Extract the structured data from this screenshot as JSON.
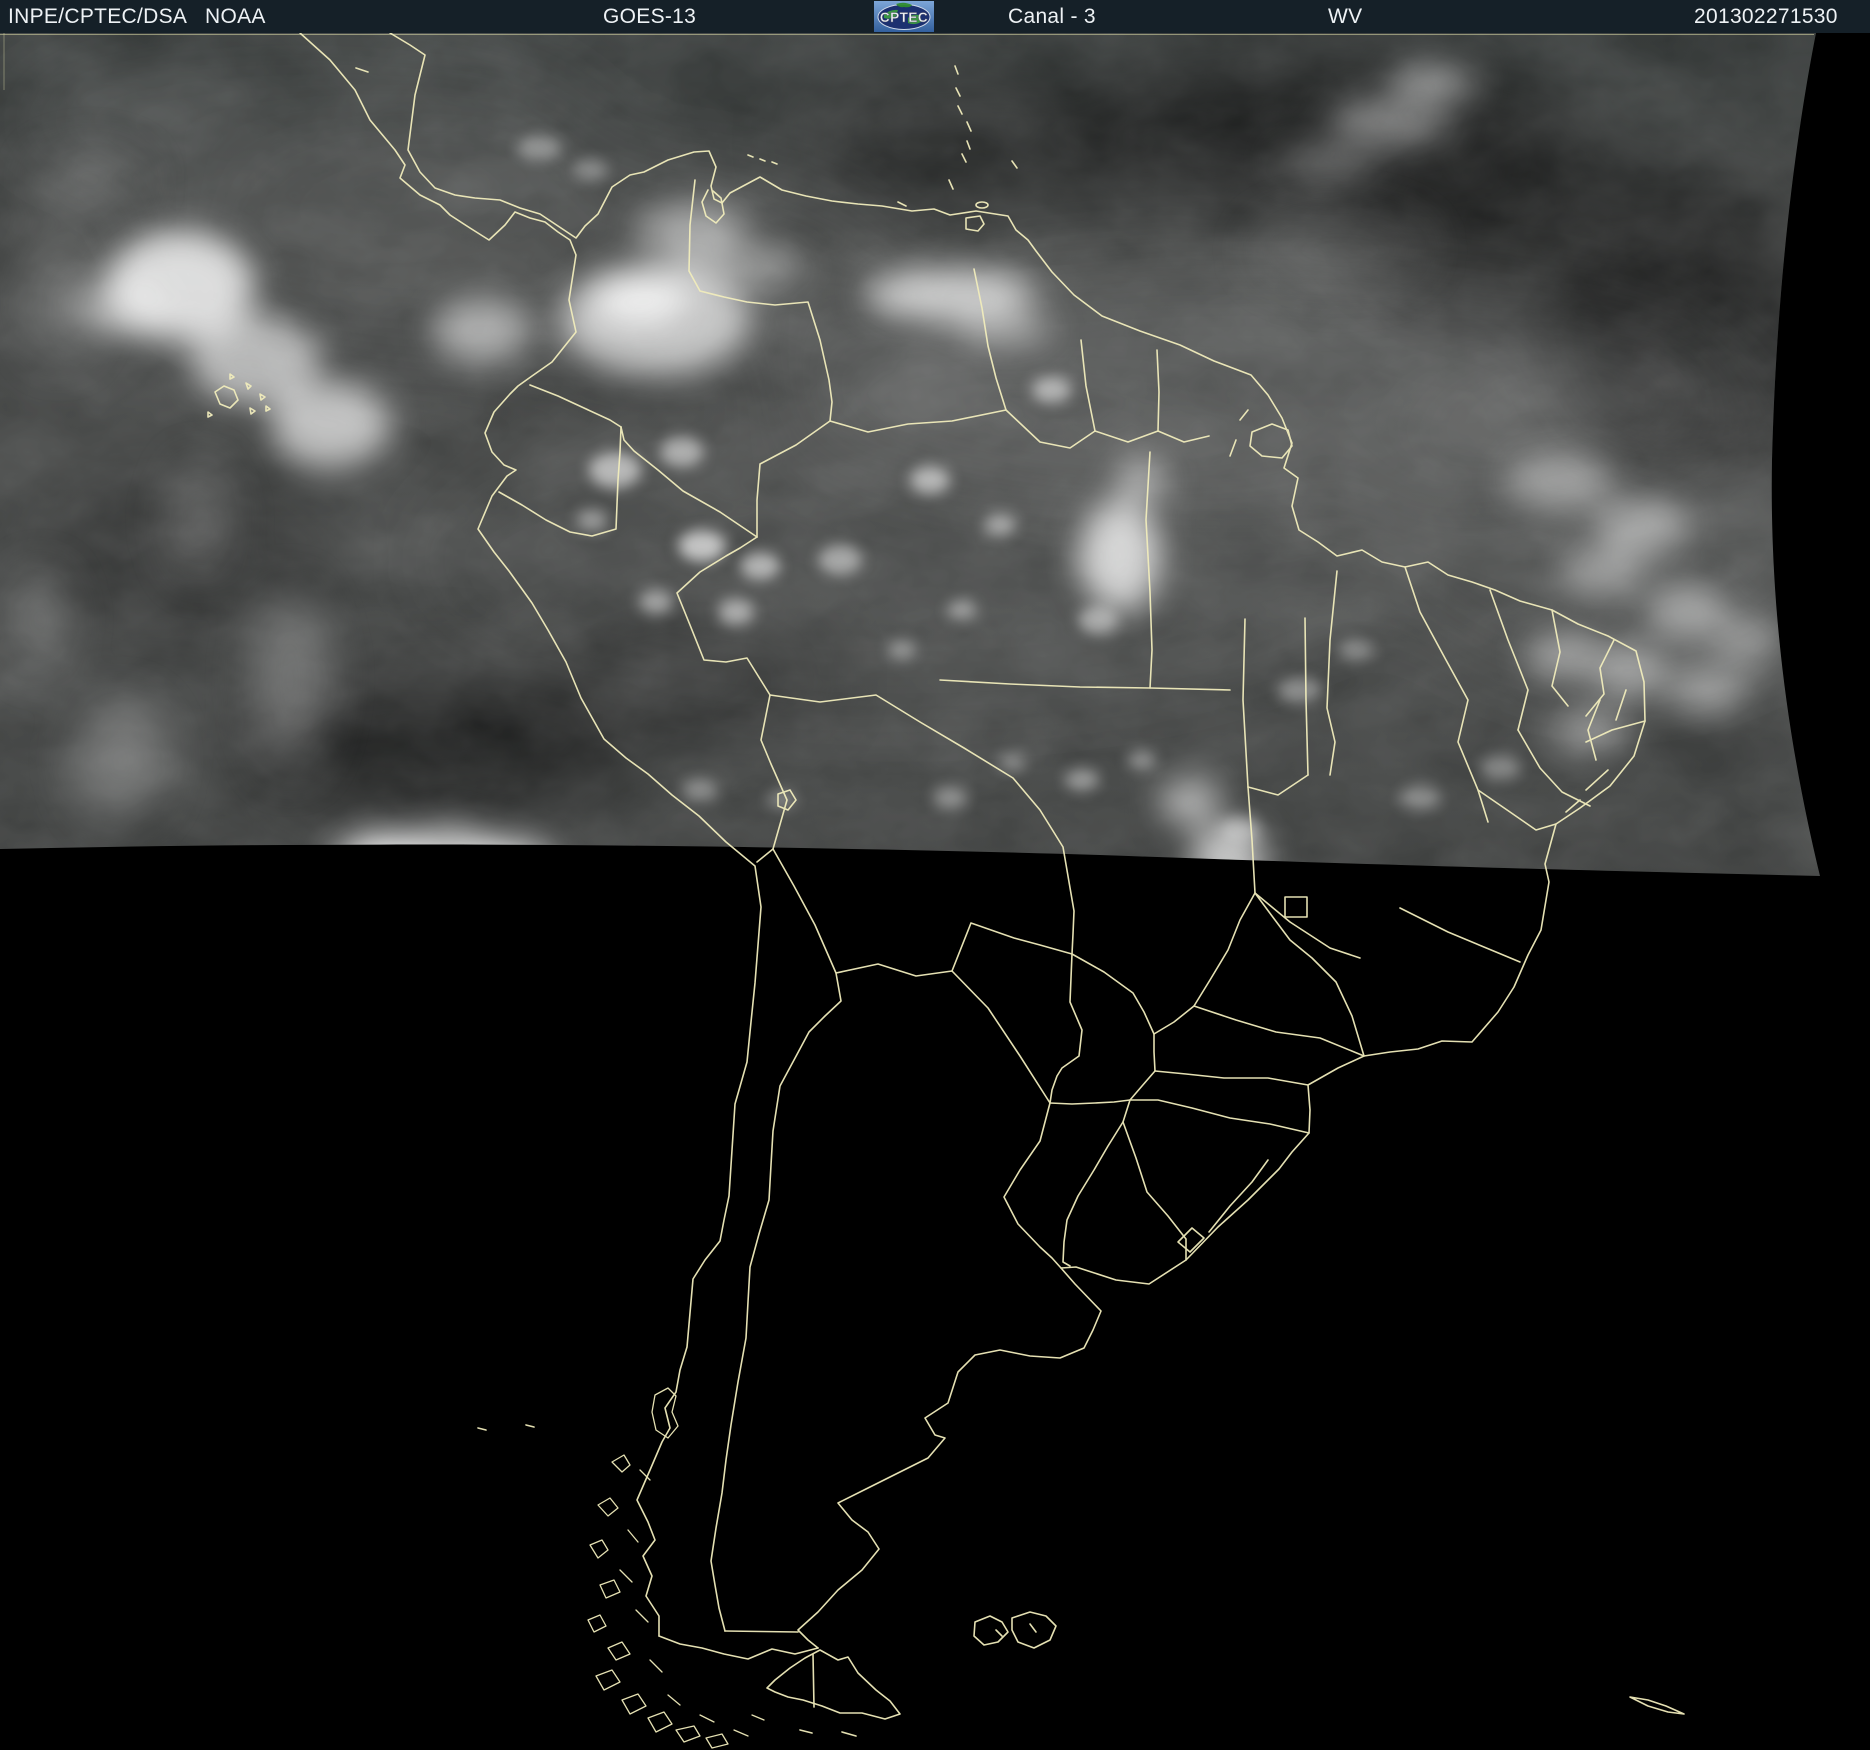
{
  "header": {
    "agency": "INPE/CPTEC/DSA",
    "noaa": "NOAA",
    "satellite": "GOES-13",
    "logo_text": "CPTEC",
    "channel": "Canal - 3",
    "product": "WV",
    "timestamp": "201302271530"
  },
  "colors": {
    "header_bg": "#152028",
    "header_text": "#eef2f5",
    "map_line": "#f1ecbc",
    "space_bg": "#000000",
    "cloud_gray_base": "#3e403f",
    "logo_blue": "#4a7fc0",
    "logo_globe": "#1c3070",
    "logo_land_green": "#3da23d"
  }
}
